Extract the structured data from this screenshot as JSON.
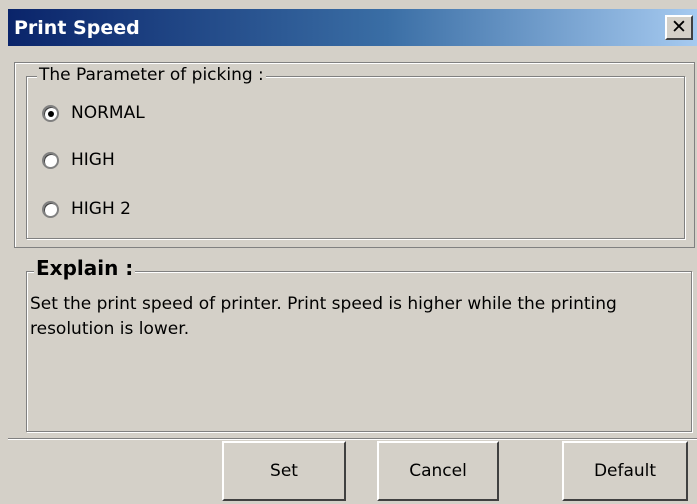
{
  "window": {
    "title": "Print Speed",
    "close_glyph": "✕",
    "close_icon": "close-icon"
  },
  "picking": {
    "legend": "The Parameter of picking :",
    "options": [
      {
        "label": "NORMAL",
        "checked": true
      },
      {
        "label": "HIGH",
        "checked": false
      },
      {
        "label": "HIGH 2",
        "checked": false
      }
    ]
  },
  "explain": {
    "legend": "Explain :",
    "text": "Set the print speed of printer. Print speed is higher while the printing resolution is lower."
  },
  "buttons": {
    "set": "Set",
    "cancel": "Cancel",
    "default": "Default"
  },
  "colors": {
    "title_gradient_start": "#0a246a",
    "title_gradient_end": "#a6caf0",
    "face": "#d4d0c8"
  }
}
